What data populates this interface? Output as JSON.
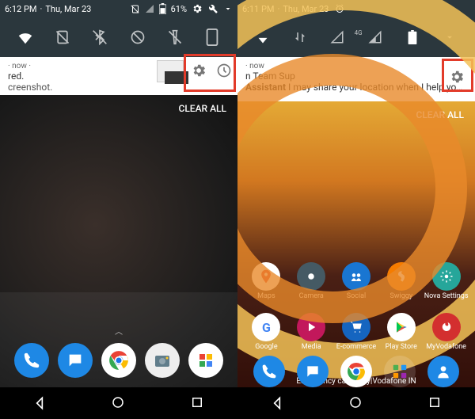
{
  "left": {
    "status": {
      "time": "6:12 PM",
      "date": "Thu, Mar 23",
      "battery": "61%"
    },
    "notif": {
      "sub": " · now ·",
      "line1": "red.",
      "line2": "creenshot."
    },
    "clear": "CLEAR ALL"
  },
  "right": {
    "status": {
      "time": "6:11 PM",
      "date": "Thu, Mar 23",
      "network": "4G"
    },
    "notif": {
      "sub": " · now",
      "title": "n Team Sup",
      "body": "Assistant I may share your location when I help you i…"
    },
    "clear": "CLEAR ALL",
    "emergency": "Emergency calls only|Vodafone IN",
    "apps_row1": [
      {
        "label": "Maps",
        "bg": "#fff"
      },
      {
        "label": "Camera",
        "bg": "#3b4a54"
      },
      {
        "label": "Social",
        "bg": "#1976d2"
      },
      {
        "label": "Swiggy",
        "bg": "#f57c00"
      },
      {
        "label": "Nova Settings",
        "bg": "#26a69a"
      }
    ],
    "apps_row2": [
      {
        "label": "Google",
        "bg": "#fff"
      },
      {
        "label": "Media",
        "bg": "#c2185b"
      },
      {
        "label": "E-commerce",
        "bg": "#1565c0"
      },
      {
        "label": "Play Store",
        "bg": "#fff"
      },
      {
        "label": "MyVodafone",
        "bg": "#d32f2f"
      }
    ]
  }
}
